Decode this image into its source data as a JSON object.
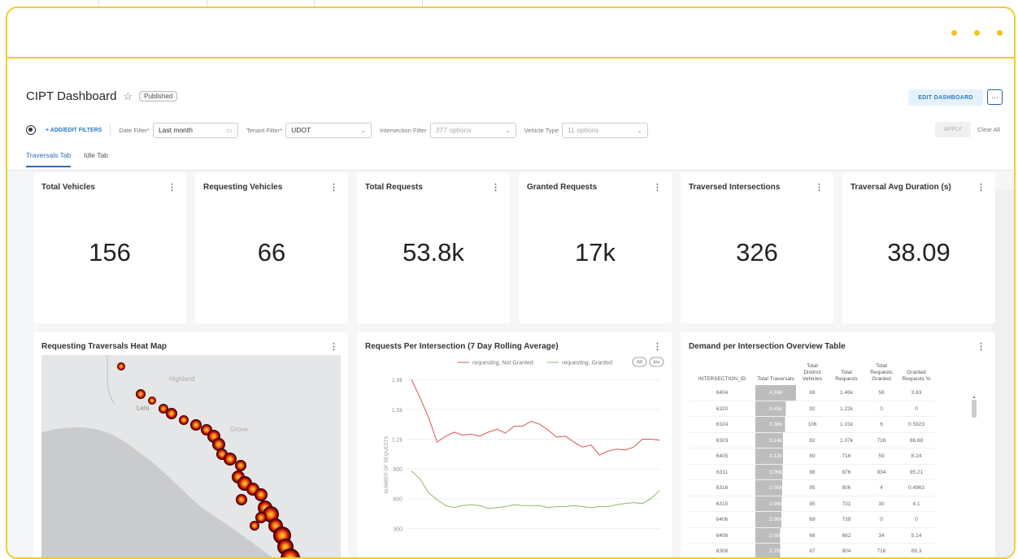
{
  "window_controls": [
    "dot",
    "dot",
    "dot"
  ],
  "header": {
    "title": "CIPT Dashboard",
    "star_icon": "☆",
    "badge": "Published",
    "edit_label": "EDIT DASHBOARD",
    "more_label": "···"
  },
  "filters": {
    "settings_icon": "gear-icon",
    "add_label": "+ ADD/EDIT FILTERS",
    "date_label": "Date Filter*",
    "date_value": "Last month",
    "tenant_label": "Tenant Filter*",
    "tenant_value": "UDOT",
    "intersection_label": "Intersection Filter",
    "intersection_value": "377 options",
    "vehicle_label": "Vehicle Type",
    "vehicle_value": "11 options",
    "apply_label": "APPLY",
    "clear_label": "Clear All"
  },
  "tabs": [
    {
      "label": "Traversals Tab",
      "active": true
    },
    {
      "label": "Idle Tab",
      "active": false
    }
  ],
  "kpis": [
    {
      "title": "Total Vehicles",
      "value": "156"
    },
    {
      "title": "Requesting Vehicles",
      "value": "66"
    },
    {
      "title": "Total Requests",
      "value": "53.8k"
    },
    {
      "title": "Granted Requests",
      "value": "17k"
    },
    {
      "title": "Traversed Intersections",
      "value": "326"
    },
    {
      "title": "Traversal Avg Duration (s)",
      "value": "38.09"
    }
  ],
  "heatmap": {
    "title": "Requesting Traversals Heat Map",
    "labels": {
      "city1": "Highland",
      "city2": "Lehi",
      "city3": "Grove"
    }
  },
  "line_chart_title": "Requests Per Intersection (7 Day Rolling Average)",
  "chart_data": {
    "type": "line",
    "title": "Requests Per Intersection (7 Day Rolling Average)",
    "ylabel": "NUMBER OF REQUESTS",
    "yticks": [
      "1.8k",
      "1.5k",
      "1.2k",
      "900",
      "600",
      "300"
    ],
    "ylim": [
      0,
      1900
    ],
    "legend_position": "top-right",
    "legend_buttons": [
      "All",
      "Inv"
    ],
    "series": [
      {
        "name": "requesting, Not Granted",
        "color": "#d9534f",
        "values": [
          1800,
          1620,
          1420,
          1170,
          1230,
          1270,
          1240,
          1250,
          1230,
          1270,
          1300,
          1260,
          1330,
          1330,
          1380,
          1350,
          1290,
          1220,
          1230,
          1170,
          1120,
          1140,
          1040,
          1080,
          1100,
          1090,
          1120,
          1200,
          1200,
          1190
        ]
      },
      {
        "name": "requesting, Granted",
        "color": "#8fb96b",
        "values": [
          880,
          800,
          660,
          590,
          530,
          510,
          530,
          540,
          530,
          500,
          510,
          520,
          540,
          530,
          530,
          530,
          510,
          520,
          520,
          530,
          520,
          510,
          520,
          520,
          540,
          550,
          560,
          550,
          600,
          680
        ]
      }
    ]
  },
  "table": {
    "title": "Demand per Intersection Overview Table",
    "columns": [
      "INTERSECTION_ID",
      "Total Traversals",
      "Total Distinct Vehicles",
      "Total Requests",
      "Total Requests Granted",
      "Granted Requests %"
    ],
    "rows": [
      [
        "6404",
        "4.59k",
        "69",
        "1.46k",
        "56",
        "3.83"
      ],
      [
        "6320",
        "3.45k",
        "92",
        "1.22k",
        "0",
        "0"
      ],
      [
        "6324",
        "3.36k",
        "106",
        "1.01k",
        "6",
        "0.5923"
      ],
      [
        "6303",
        "3.14k",
        "82",
        "1.07k",
        "716",
        "66.88"
      ],
      [
        "6405",
        "3.12k",
        "69",
        "716",
        "59",
        "8.24"
      ],
      [
        "6311",
        "3.09k",
        "88",
        "876",
        "834",
        "95.21"
      ],
      [
        "6316",
        "3.05k",
        "95",
        "806",
        "4",
        "0.4963"
      ],
      [
        "6315",
        "2.98k",
        "95",
        "731",
        "30",
        "4.1"
      ],
      [
        "6406",
        "2.96k",
        "69",
        "739",
        "0",
        "0"
      ],
      [
        "6408",
        "2.80k",
        "66",
        "662",
        "34",
        "5.14"
      ],
      [
        "6308",
        "2.79k",
        "87",
        "804",
        "716",
        "89.3"
      ]
    ],
    "traversal_fractions": [
      1.0,
      0.75,
      0.73,
      0.68,
      0.68,
      0.67,
      0.66,
      0.65,
      0.64,
      0.61,
      0.61
    ]
  }
}
